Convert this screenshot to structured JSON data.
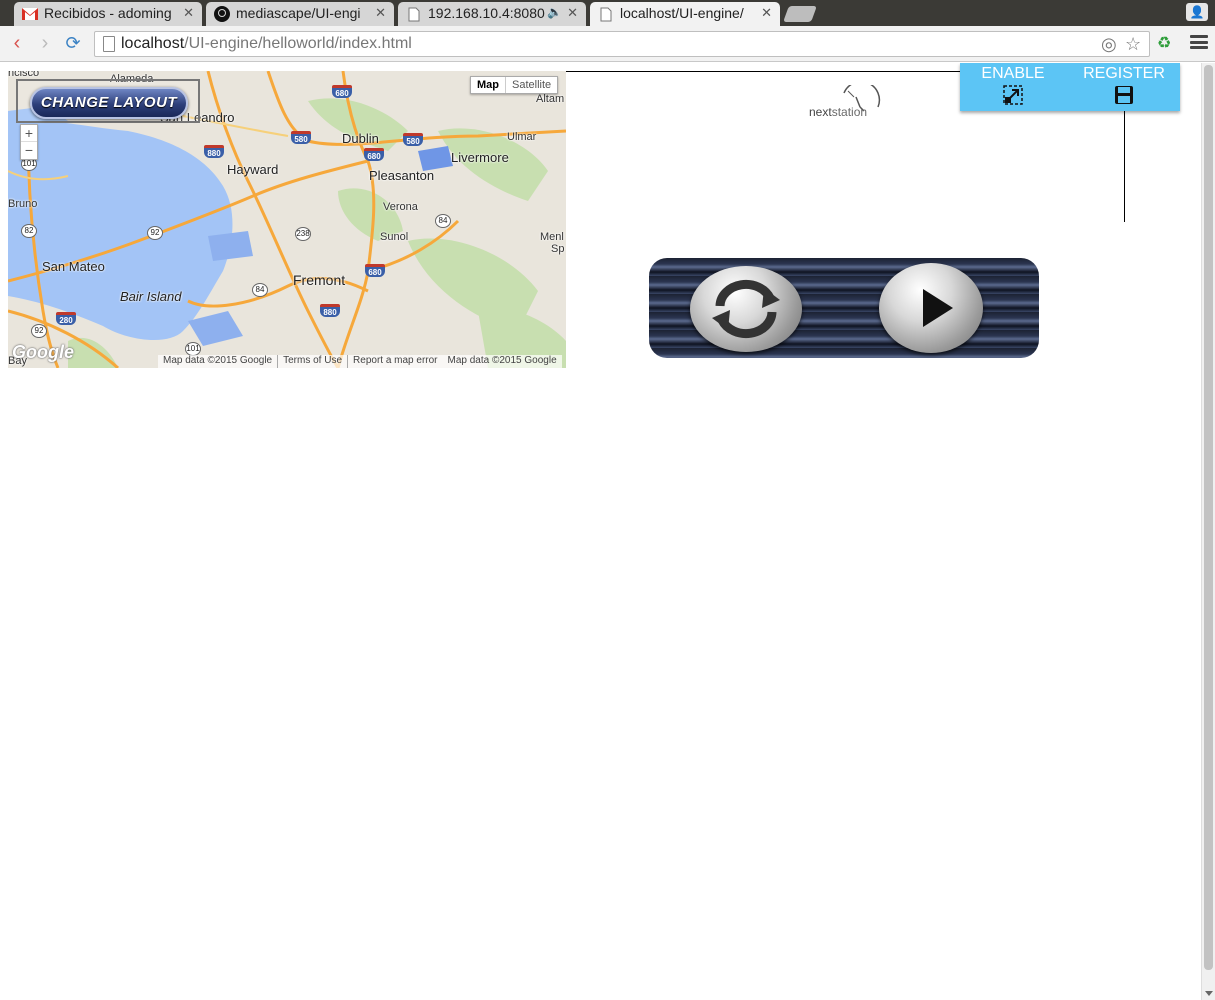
{
  "browser": {
    "tabs": [
      {
        "title": "Recibidos - adoming",
        "icon": "gmail-icon"
      },
      {
        "title": "mediascape/UI-engi",
        "icon": "github-icon"
      },
      {
        "title": "192.168.10.4:8080",
        "icon": "page-icon",
        "audio": true
      },
      {
        "title": "localhost/UI-engine/",
        "icon": "page-icon",
        "active": true
      }
    ],
    "url_host": "localhost",
    "url_path": "/UI-engine/helloworld/index.html"
  },
  "page": {
    "change_layout_label": "CHANGE LAYOUT",
    "controls": {
      "enable_label": "ENABLE",
      "register_label": "REGISTER"
    },
    "logo": {
      "text_a": "next",
      "text_b": "station"
    },
    "map": {
      "type_buttons": [
        "Map",
        "Satellite"
      ],
      "places": {
        "alameda": "Alameda",
        "san_leandro": "San Leandro",
        "hayward": "Hayward",
        "dublin": "Dublin",
        "livermore": "Livermore",
        "pleasanton": "Pleasanton",
        "verona": "Verona",
        "sunol": "Sunol",
        "fremont": "Fremont",
        "san_mateo": "San Mateo",
        "bair_island": "Bair Island",
        "bruno": "Bruno",
        "altam": "Altam",
        "ulmar": "Ulmar",
        "menl": "Menl",
        "sp": "Sp",
        "ncisco": "ncisco",
        "bay": "Bay"
      },
      "shields": {
        "i680a": "680",
        "i580a": "580",
        "i580b": "580",
        "i880a": "880",
        "i680b": "680",
        "i680c": "680",
        "i880b": "880",
        "i280": "280",
        "s101a": "101",
        "s82": "82",
        "s92a": "92",
        "s238": "238",
        "s84a": "84",
        "s84b": "84",
        "s92b": "92",
        "s101b": "101"
      },
      "footer": [
        "Map data ©2015 Google",
        "Terms of Use",
        "Report a map error",
        "Map data ©2015 Google"
      ],
      "logo": "Google"
    }
  },
  "colors": {
    "water": "#a3c4f6",
    "land": "#e9e5dc",
    "park": "#c8dfb0",
    "highway": "#f6a83b",
    "control_box": "#5cc5f5"
  }
}
